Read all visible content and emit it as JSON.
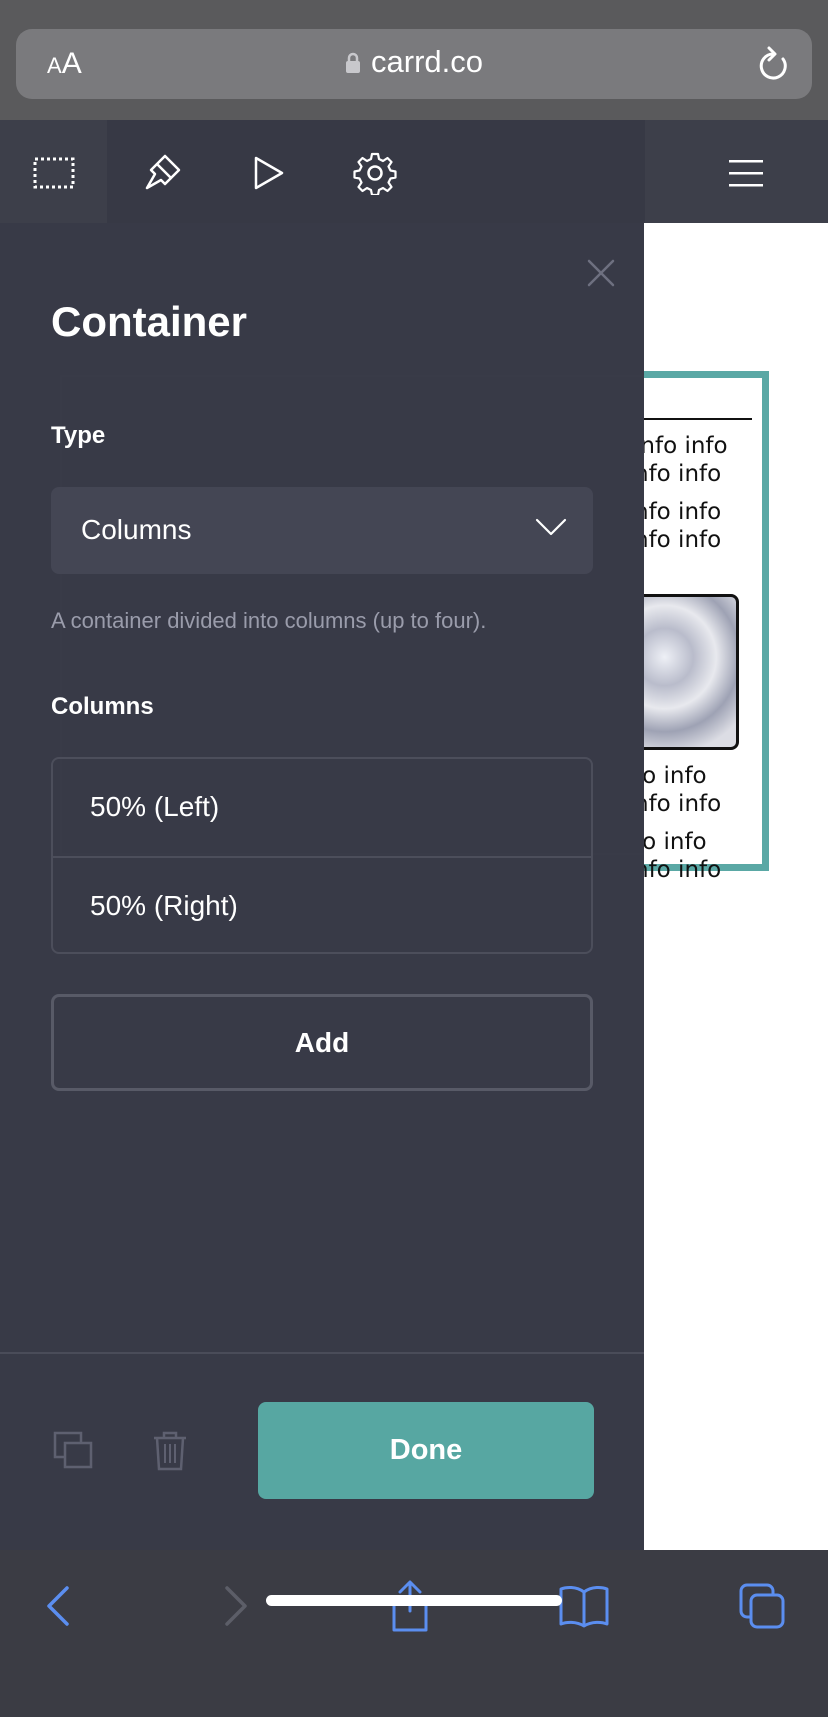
{
  "browser": {
    "text_size_label_small": "A",
    "text_size_label_large": "A",
    "url": "carrd.co"
  },
  "toolbar": {
    "icons": [
      "select-icon",
      "brush-icon",
      "play-icon",
      "gear-icon",
      "menu-icon"
    ]
  },
  "panel": {
    "title": "Container",
    "type_label": "Type",
    "type_value": "Columns",
    "type_help": "A container divided into columns (up to four).",
    "columns_label": "Columns",
    "columns": [
      {
        "label": "50% (Left)"
      },
      {
        "label": "50% (Right)"
      }
    ],
    "add_label": "Add",
    "done_label": "Done"
  },
  "preview": {
    "text_lines": [
      "info info",
      "nfo info",
      "nfo info",
      "nfo info",
      "fo info",
      "nfo info",
      "fo info",
      "nfo info"
    ]
  },
  "colors": {
    "accent": "#57a7a2",
    "panel_bg": "#383a47",
    "toolbar_bg": "#3d3f4a",
    "safari_icon": "#5b8ef0"
  }
}
